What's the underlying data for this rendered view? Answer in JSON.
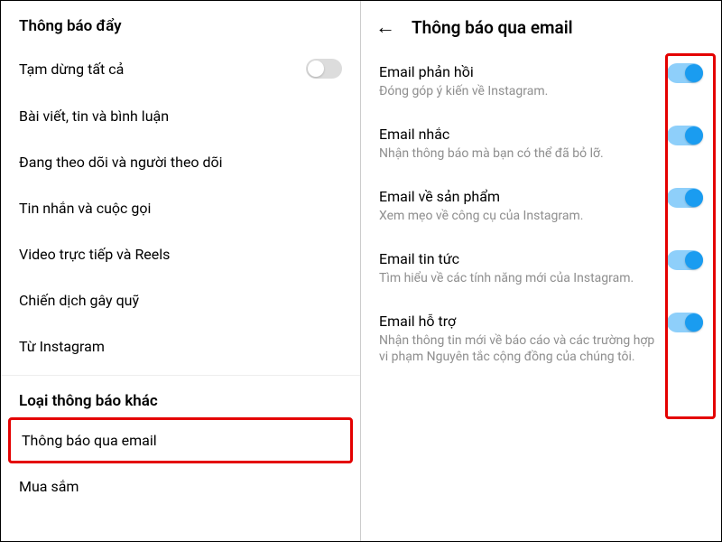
{
  "left": {
    "title": "Thông báo đẩy",
    "pause_all": "Tạm dừng tất cả",
    "items": [
      "Bài viết, tin và bình luận",
      "Đang theo dõi và người theo dõi",
      "Tin nhắn và cuộc gọi",
      "Video trực tiếp và Reels",
      "Chiến dịch gây quỹ",
      "Từ Instagram"
    ],
    "other_section": "Loại thông báo khác",
    "email_notifications": "Thông báo qua email",
    "shopping": "Mua sắm"
  },
  "right": {
    "title": "Thông báo qua email",
    "rows": [
      {
        "label": "Email phản hồi",
        "desc": "Đóng góp ý kiến về Instagram."
      },
      {
        "label": "Email nhắc",
        "desc": "Nhận thông báo mà bạn có thể đã bỏ lỡ."
      },
      {
        "label": "Email về sản phẩm",
        "desc": "Xem mẹo về công cụ của Instagram."
      },
      {
        "label": "Email tin tức",
        "desc": "Tìm hiểu về các tính năng mới của Instagram."
      },
      {
        "label": "Email hỗ trợ",
        "desc": "Nhận thông tin mới về báo cáo và các trường hợp vi phạm Nguyên tắc cộng đồng của chúng tôi."
      }
    ]
  }
}
